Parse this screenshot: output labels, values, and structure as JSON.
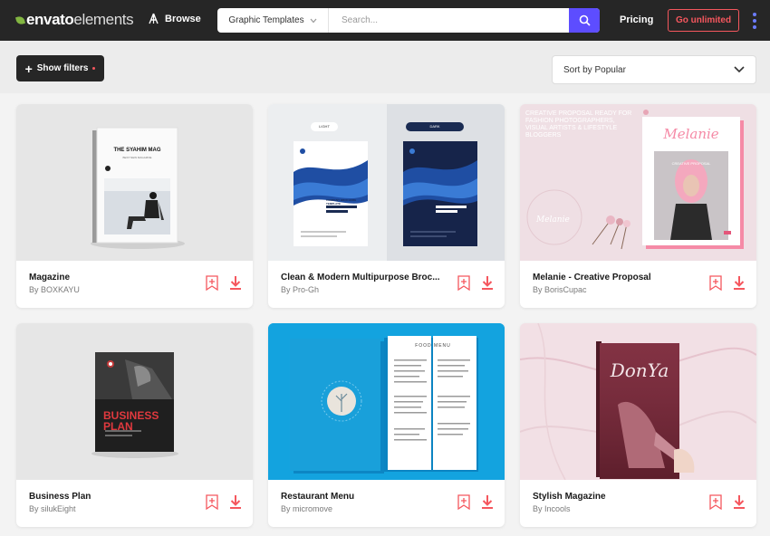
{
  "header": {
    "logo_bold": "envato",
    "logo_light": "elements",
    "browse_label": "Browse",
    "category_value": "Graphic Templates",
    "search_placeholder": "Search...",
    "pricing_label": "Pricing",
    "cta_label": "Go unlimited"
  },
  "toolbar": {
    "filters_label": "Show filters",
    "sort_value": "Sort by Popular"
  },
  "colors": {
    "accent_purple": "#5d4dff",
    "cta_red": "#f5575e",
    "header_bg": "#262626"
  },
  "cards": [
    {
      "title": "Magazine",
      "author": "By BOXKAYU",
      "cover_title": "THE SYAHIM MAG",
      "cover_sub": "BEST NEW MAGAZINE"
    },
    {
      "title": "Clean & Modern Multipurpose Broc...",
      "author": "By Pro-Gh",
      "tag_light": "LIGHT",
      "tag_dark": "DARK",
      "cover_text": "COMPANY BROCHURE TEMPLATE"
    },
    {
      "title": "Melanie - Creative Proposal",
      "author": "By BorisCupac",
      "bg_text": "CREATIVE PROPOSAL READY FOR FASHION PHOTOGRAPHERS, VISUAL ARTISTS & LIFESTYLE BLOGGERS",
      "cover_title": "Melanie",
      "cover_sub": "CREATIVE PROPOSAL",
      "side_script": "Melanie"
    },
    {
      "title": "Business Plan",
      "author": "By silukEight",
      "cover_line1": "BUSINESS",
      "cover_line2": "PLAN"
    },
    {
      "title": "Restaurant Menu",
      "author": "By micromove",
      "menu_heading": "FOOD MENU"
    },
    {
      "title": "Stylish Magazine",
      "author": "By Incools",
      "cover_title": "DonYa"
    }
  ]
}
